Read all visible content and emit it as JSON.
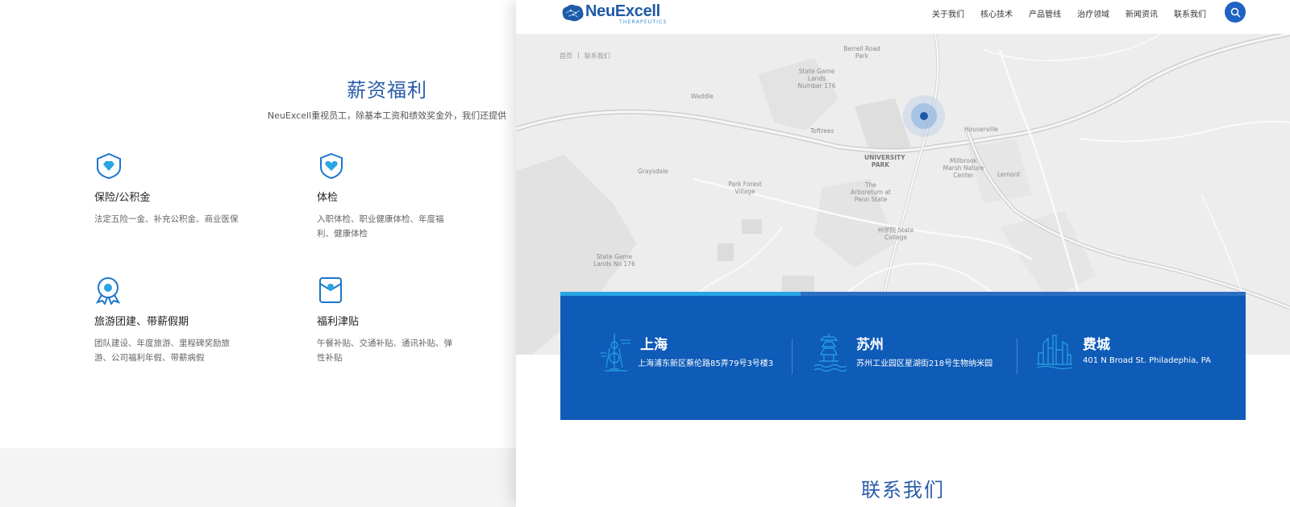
{
  "benefits": {
    "title": "薪资福利",
    "subtitle": "NeuExcell重视员工，除基本工资和绩效奖金外，我们还提供",
    "items": [
      {
        "icon": "diamond-shield-icon",
        "title": "保险/公积金",
        "desc": "法定五险一金、补充公积金、商业医保"
      },
      {
        "icon": "heart-shield-icon",
        "title": "体检",
        "desc": "入职体检、职业健康体检、年度福利、健康体检"
      },
      {
        "icon": "award-badge-icon",
        "title": "旅游团建、带薪假期",
        "desc": "团队建设、年度旅游、里程碑奖励旅游、公司福利年假、带薪病假"
      },
      {
        "icon": "envelope-icon",
        "title": "福利津贴",
        "desc": "午餐补贴、交通补贴、通讯补贴、弹性补贴"
      }
    ]
  },
  "header": {
    "logo_text": "NeuExcell",
    "logo_sub": "THERAPEUTICS",
    "nav": [
      "关于我们",
      "核心技术",
      "产品管线",
      "治疗领域",
      "新闻资讯",
      "联系我们"
    ],
    "search_icon": "search-icon"
  },
  "breadcrumb": {
    "home": "首页",
    "separator": "|",
    "current": "联系我们"
  },
  "map": {
    "labels": [
      "Berrell Road Park",
      "State Game Lands Number 176",
      "Waddle",
      "Toftrees",
      "Houserville",
      "UNIVERSITY PARK",
      "Millbrook Marsh Nature Center",
      "Graysdale",
      "Lemont",
      "Park Forest Village",
      "The Arboretum at Penn State",
      "州学院 State College",
      "State Game Lands No 176"
    ]
  },
  "offices": {
    "progress": 0.35,
    "items": [
      {
        "icon": "tv-tower-icon",
        "city": "上海",
        "address": "上海浦东新区蔡伦路85弄79号3号楼3"
      },
      {
        "icon": "pagoda-icon",
        "city": "苏州",
        "address": "苏州工业园区星湖街218号生物纳米园"
      },
      {
        "icon": "city-skyline-icon",
        "city": "费城",
        "address": "401 N Broad St. Philadephia, PA"
      }
    ]
  },
  "contact": {
    "title": "联系我们"
  },
  "colors": {
    "primary": "#2a5caa",
    "panel": "#0e5bb8",
    "accent": "#2aa5e4",
    "map_bg": "#ededed"
  }
}
